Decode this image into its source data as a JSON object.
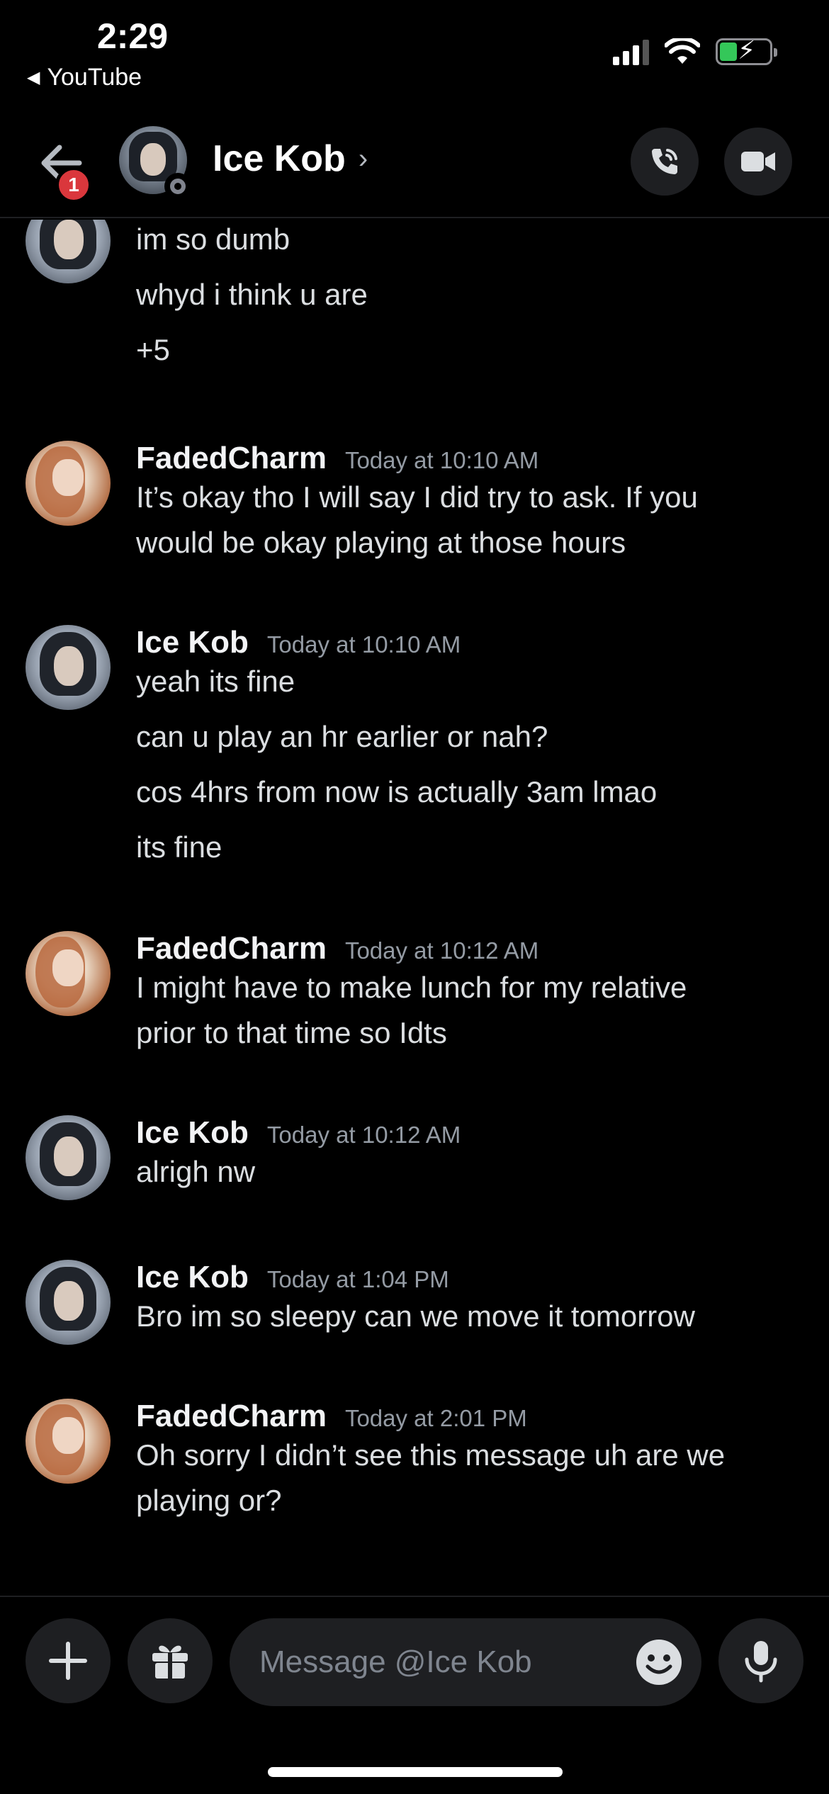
{
  "status_bar": {
    "time": "2:29",
    "back_app": "YouTube"
  },
  "header": {
    "unread_badge": "1",
    "contact_name": "Ice Kob",
    "chevron": "›"
  },
  "messages": [
    {
      "author": "",
      "timestamp": "",
      "avatar": "ice",
      "lines": [
        "im so dumb",
        "whyd i think u are",
        "+5"
      ]
    },
    {
      "author": "FadedCharm",
      "timestamp": "Today at 10:10 AM",
      "avatar": "faded",
      "lines": [
        "It’s okay tho I will say I did try to ask. If you",
        "would be okay playing at those hours"
      ]
    },
    {
      "author": "Ice Kob",
      "timestamp": "Today at 10:10 AM",
      "avatar": "ice",
      "lines": [
        "yeah its fine",
        "can u play an hr earlier or nah?",
        "cos 4hrs from now is actually 3am lmao",
        "its fine"
      ]
    },
    {
      "author": "FadedCharm",
      "timestamp": "Today at 10:12 AM",
      "avatar": "faded",
      "lines": [
        "I might have to make lunch for my relative",
        "prior to that time so Idts"
      ]
    },
    {
      "author": "Ice Kob",
      "timestamp": "Today at 10:12 AM",
      "avatar": "ice",
      "lines": [
        "alrigh nw"
      ]
    },
    {
      "author": "Ice Kob",
      "timestamp": "Today at 1:04 PM",
      "avatar": "ice",
      "lines": [
        "Bro im so sleepy can we move it tomorrow"
      ]
    },
    {
      "author": "FadedCharm",
      "timestamp": "Today at 2:01 PM",
      "avatar": "faded",
      "lines": [
        "Oh sorry I didn’t see this message uh are we",
        "playing or?"
      ]
    }
  ],
  "composer": {
    "placeholder": "Message @Ice Kob"
  }
}
